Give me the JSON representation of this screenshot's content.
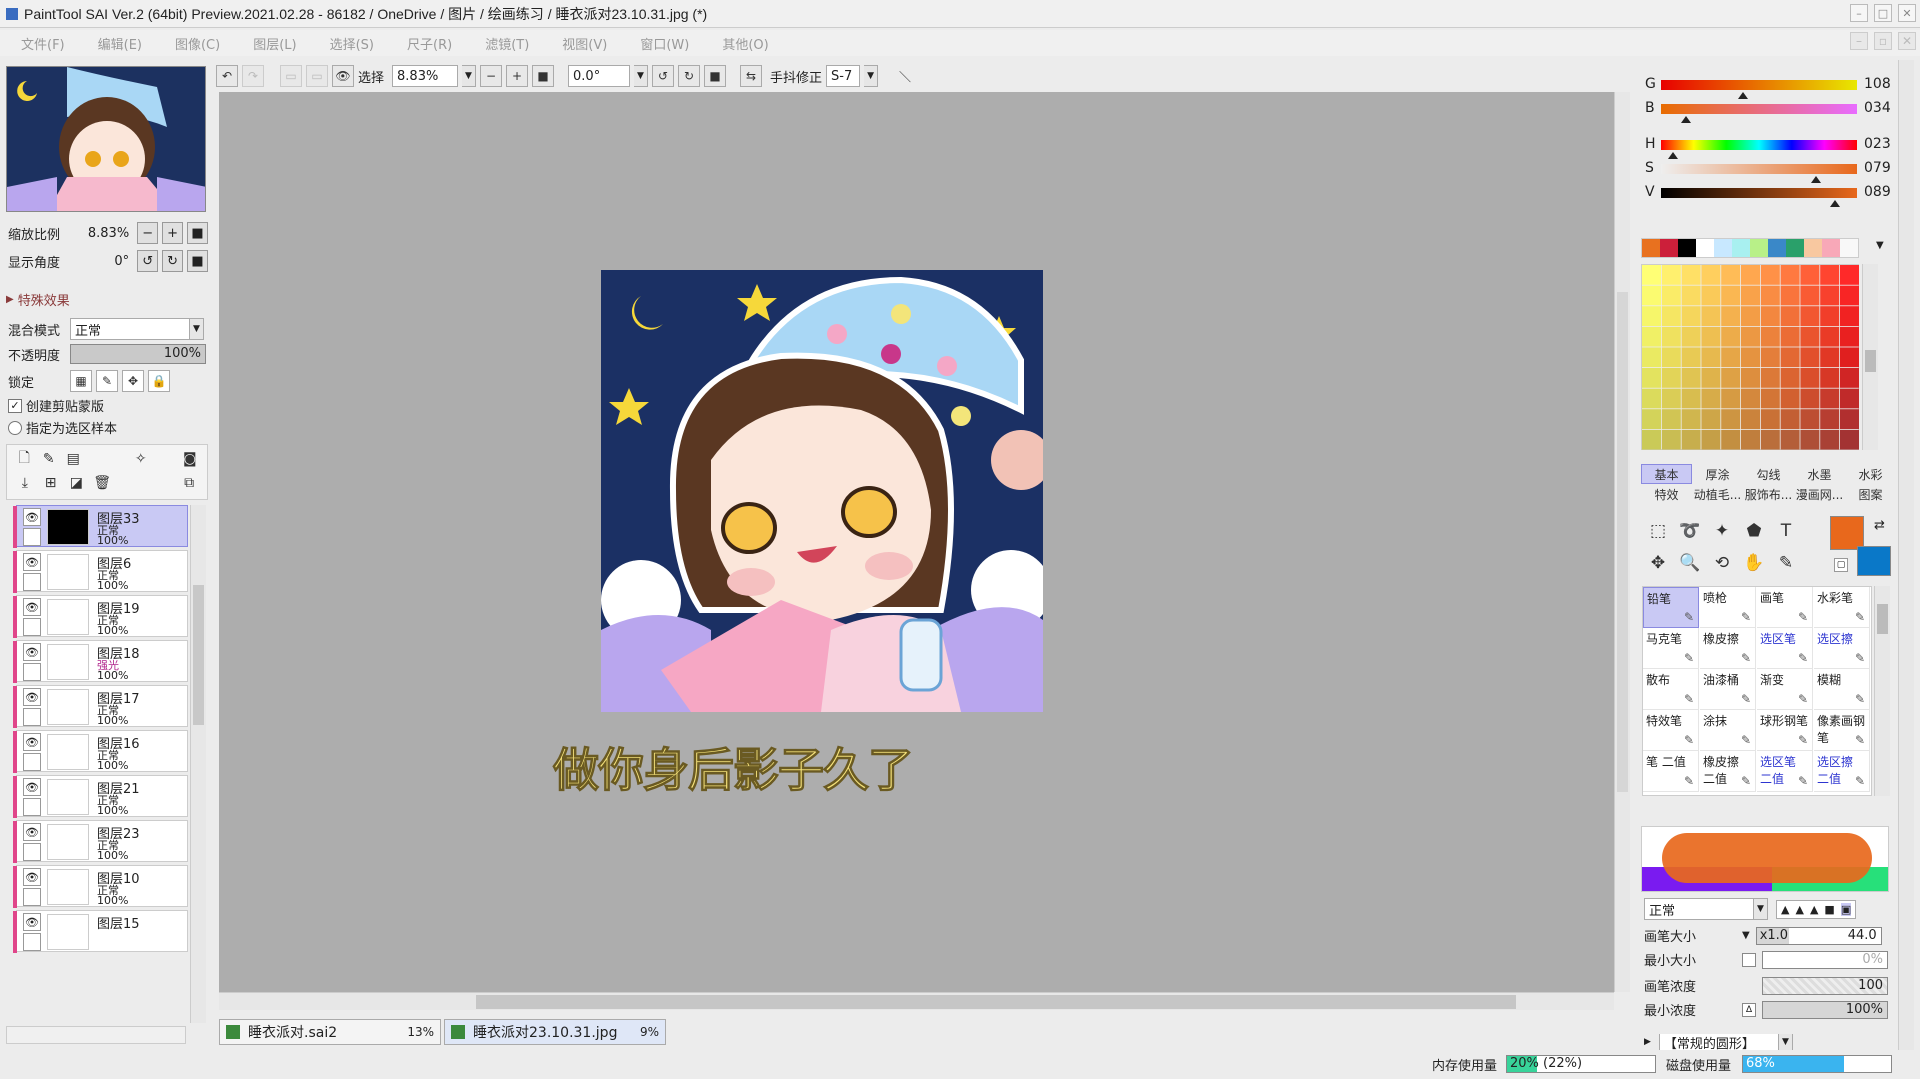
{
  "titlebar": {
    "title": "PaintTool SAI Ver.2 (64bit) Preview.2021.02.28 - 86182 / OneDrive / 图片 / 绘画练习 / 睡衣派对23.10.31.jpg (*)"
  },
  "menu": [
    "文件(F)",
    "编辑(E)",
    "图像(C)",
    "图层(L)",
    "选择(S)",
    "尺子(R)",
    "滤镜(T)",
    "视图(V)",
    "窗口(W)",
    "其他(O)"
  ],
  "toolbar": {
    "selection_label": "选择",
    "zoom_value": "8.83%",
    "angle_value": "0.0°",
    "stabilizer_label": "手抖修正",
    "stabilizer_value": "S-7"
  },
  "navigator": {
    "zoom_label": "缩放比例",
    "zoom_value": "8.83%",
    "angle_label": "显示角度",
    "angle_value": "0°"
  },
  "layer_props": {
    "effects_header": "特殊效果",
    "blend_label": "混合模式",
    "blend_value": "正常",
    "opacity_label": "不透明度",
    "opacity_value": "100%",
    "opacity_level": 1.0,
    "lock_label": "锁定",
    "clip_label": "创建剪贴蒙版",
    "clip_checked": true,
    "sample_label": "指定为选区样本",
    "sample_checked": false
  },
  "layers": [
    {
      "name": "图层33",
      "mode": "正常",
      "opacity": "100%",
      "selected": true,
      "thumb": "black"
    },
    {
      "name": "图层6",
      "mode": "正常",
      "opacity": "100%",
      "selected": false,
      "thumb": "sketch"
    },
    {
      "name": "图层19",
      "mode": "正常",
      "opacity": "100%",
      "selected": false,
      "thumb": "white"
    },
    {
      "name": "图层18",
      "mode": "强光",
      "opacity": "100%",
      "selected": false,
      "thumb": "white"
    },
    {
      "name": "图层17",
      "mode": "正常",
      "opacity": "100%",
      "selected": false,
      "thumb": "white"
    },
    {
      "name": "图层16",
      "mode": "正常",
      "opacity": "100%",
      "selected": false,
      "thumb": "white"
    },
    {
      "name": "图层21",
      "mode": "正常",
      "opacity": "100%",
      "selected": false,
      "thumb": "white"
    },
    {
      "name": "图层23",
      "mode": "正常",
      "opacity": "100%",
      "selected": false,
      "thumb": "white"
    },
    {
      "name": "图层10",
      "mode": "正常",
      "opacity": "100%",
      "selected": false,
      "thumb": "white"
    },
    {
      "name": "图层15",
      "mode": "",
      "opacity": "",
      "selected": false,
      "thumb": "white"
    }
  ],
  "color_sliders": [
    {
      "label": "G",
      "value": "108",
      "fraction": 0.42
    },
    {
      "label": "B",
      "value": "034",
      "fraction": 0.13
    },
    {
      "label": "H",
      "value": "023",
      "fraction": 0.06
    },
    {
      "label": "S",
      "value": "079",
      "fraction": 0.79
    },
    {
      "label": "V",
      "value": "089",
      "fraction": 0.89
    }
  ],
  "swatches": [
    "#e8711f",
    "#cc1f3a",
    "#000000",
    "#ffffff",
    "#c8e8ff",
    "#a8f0f0",
    "#b8f088",
    "#3a88c8",
    "#2aa06a",
    "#f8c8a0",
    "#f8a8b8",
    "#f8f8f8"
  ],
  "tool_tabs": [
    "基本",
    "厚涂",
    "勾线",
    "水墨",
    "水彩",
    "特效",
    "动植毛...",
    "服饰布...",
    "漫画网...",
    "图案"
  ],
  "active_tab": "基本",
  "tools": [
    "select-rect-icon",
    "lasso-icon",
    "magic-wand-icon",
    "fill-shape-icon",
    "text-icon",
    "move-icon",
    "zoom-icon",
    "rotate-icon",
    "hand-icon",
    "eyedropper-icon"
  ],
  "primary_color": "#e8681c",
  "secondary_color": "#0a78c8",
  "brushes": [
    {
      "label": "铅笔",
      "sel": true,
      "blue": false
    },
    {
      "label": "喷枪",
      "sel": false,
      "blue": false
    },
    {
      "label": "画笔",
      "sel": false,
      "blue": false
    },
    {
      "label": "水彩笔",
      "sel": false,
      "blue": false
    },
    {
      "label": "马克笔",
      "sel": false,
      "blue": false
    },
    {
      "label": "橡皮擦",
      "sel": false,
      "blue": false
    },
    {
      "label": "选区笔",
      "sel": false,
      "blue": true
    },
    {
      "label": "选区擦",
      "sel": false,
      "blue": true
    },
    {
      "label": "散布",
      "sel": false,
      "blue": false
    },
    {
      "label": "油漆桶",
      "sel": false,
      "blue": false
    },
    {
      "label": "渐变",
      "sel": false,
      "blue": false
    },
    {
      "label": "模糊",
      "sel": false,
      "blue": false
    },
    {
      "label": "特效笔",
      "sel": false,
      "blue": false
    },
    {
      "label": "涂抹",
      "sel": false,
      "blue": false
    },
    {
      "label": "球形钢笔",
      "sel": false,
      "blue": false
    },
    {
      "label": "像素画钢笔",
      "sel": false,
      "blue": false
    },
    {
      "label": "笔 二值",
      "sel": false,
      "blue": false
    },
    {
      "label": "橡皮擦 二值",
      "sel": false,
      "blue": false
    },
    {
      "label": "选区笔 二值",
      "sel": false,
      "blue": true
    },
    {
      "label": "选区擦 二值",
      "sel": false,
      "blue": true
    }
  ],
  "brush_settings": {
    "mode": "正常",
    "size_label": "画笔大小",
    "size_mult": "x1.0",
    "size_value": "44.0",
    "min_size_label": "最小大小",
    "min_size_value": "0%",
    "density_label": "画笔浓度",
    "density_value": "100",
    "min_density_label": "最小浓度",
    "min_density_value": "100%",
    "shape_label": "【常规的圆形】"
  },
  "doc_tabs": [
    {
      "name": "睡衣派对.sai2",
      "zoom": "13%",
      "active": false
    },
    {
      "name": "睡衣派对23.10.31.jpg",
      "zoom": "9%",
      "active": true
    }
  ],
  "status": {
    "memory_label": "内存使用量",
    "memory_value": "20% (22%)",
    "memory_fraction": 0.2,
    "disk_label": "磁盘使用量",
    "disk_value": "68%",
    "disk_fraction": 0.68
  },
  "subtitle": "做你身后影子久了"
}
